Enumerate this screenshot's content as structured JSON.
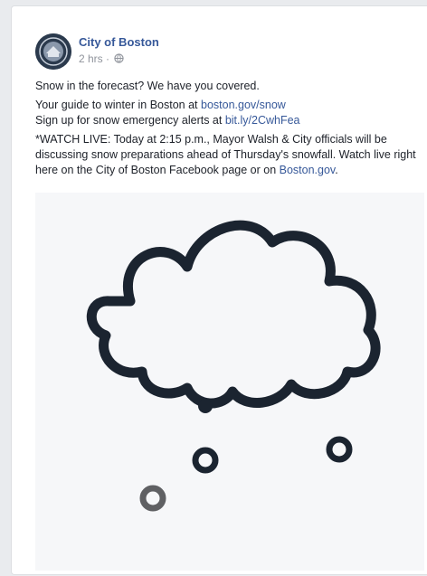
{
  "post": {
    "page_name": "City of Boston",
    "time": "2 hrs",
    "separator": " · ",
    "privacy_icon": "globe-icon",
    "avatar_icon": "city-seal-icon",
    "line1": "Snow in the forecast? We have you covered.",
    "guide_prefix": "Your guide to winter in Boston at ",
    "guide_link": "boston.gov/snow",
    "signup_prefix": "Sign up for snow emergency alerts at ",
    "signup_link": "bit.ly/2CwhFea",
    "watch_text": "*WATCH LIVE: Today at 2:15 p.m., Mayor Walsh & City officials will be discussing snow preparations ahead of Thursday's snowfall. Watch live right here on the City of Boston Facebook page or on ",
    "watch_link": "Boston.gov",
    "watch_suffix": "."
  },
  "media": {
    "image_icon": "snow-cloud-icon",
    "colors": {
      "outline": "#1b2430",
      "flake_dark": "#1b2430",
      "flake_gray": "#5f6063"
    }
  },
  "colors": {
    "link": "#365899",
    "page_bg": "#e9ebee"
  }
}
